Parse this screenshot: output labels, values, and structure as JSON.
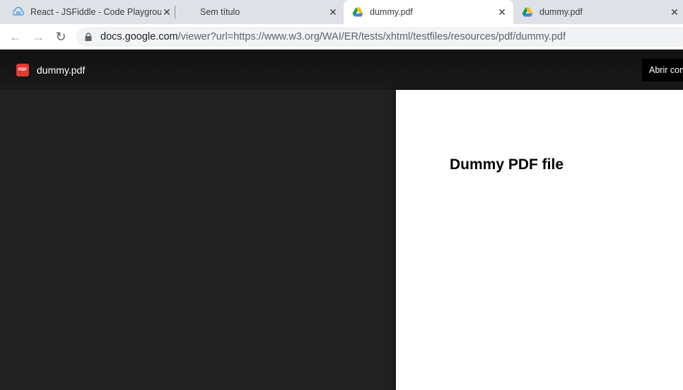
{
  "browser": {
    "tabs": [
      {
        "title": "React - JSFiddle - Code Playground",
        "icon": "jsfiddle-icon",
        "active": false
      },
      {
        "title": "Sem título",
        "icon": "none",
        "active": false
      },
      {
        "title": "dummy.pdf",
        "icon": "google-drive-icon",
        "active": true
      },
      {
        "title": "dummy.pdf",
        "icon": "google-drive-icon",
        "active": false
      }
    ],
    "url_host": "docs.google.com",
    "url_path": "/viewer?url=https://www.w3.org/WAI/ER/tests/xhtml/testfiles/resources/pdf/dummy.pdf"
  },
  "viewer": {
    "pdf_badge": "PDF",
    "file_name": "dummy.pdf",
    "open_with_label": "Abrir com"
  },
  "document": {
    "title": "Dummy PDF file"
  }
}
